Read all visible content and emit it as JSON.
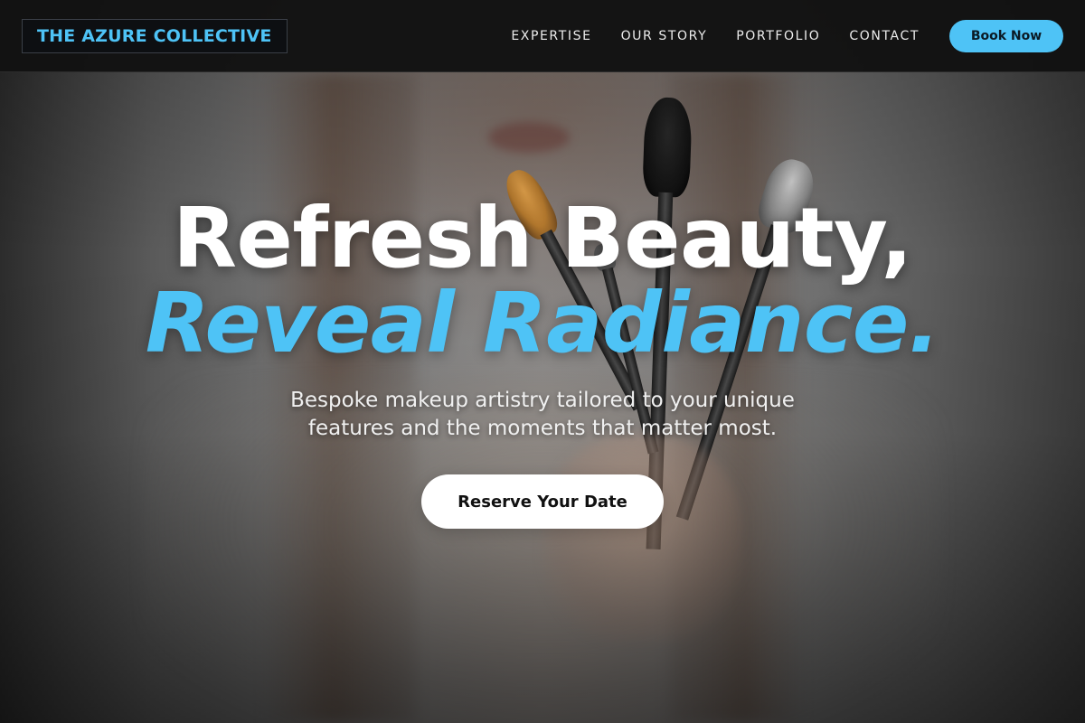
{
  "header": {
    "logo": "THE AZURE COLLECTIVE",
    "nav": [
      "EXPERTISE",
      "OUR STORY",
      "PORTFOLIO",
      "CONTACT"
    ],
    "cta": "Book Now"
  },
  "hero": {
    "headline_line1": "Refresh Beauty,",
    "headline_line2": "Reveal Radiance.",
    "subtitle": "Bespoke makeup artistry tailored to your unique features and the moments that matter most.",
    "button": "Reserve Your Date",
    "background_image": "woman-holding-makeup-brushes"
  },
  "colors": {
    "accent": "#4ec3f6",
    "header_bg": "#121212",
    "button_bg": "#ffffff"
  }
}
